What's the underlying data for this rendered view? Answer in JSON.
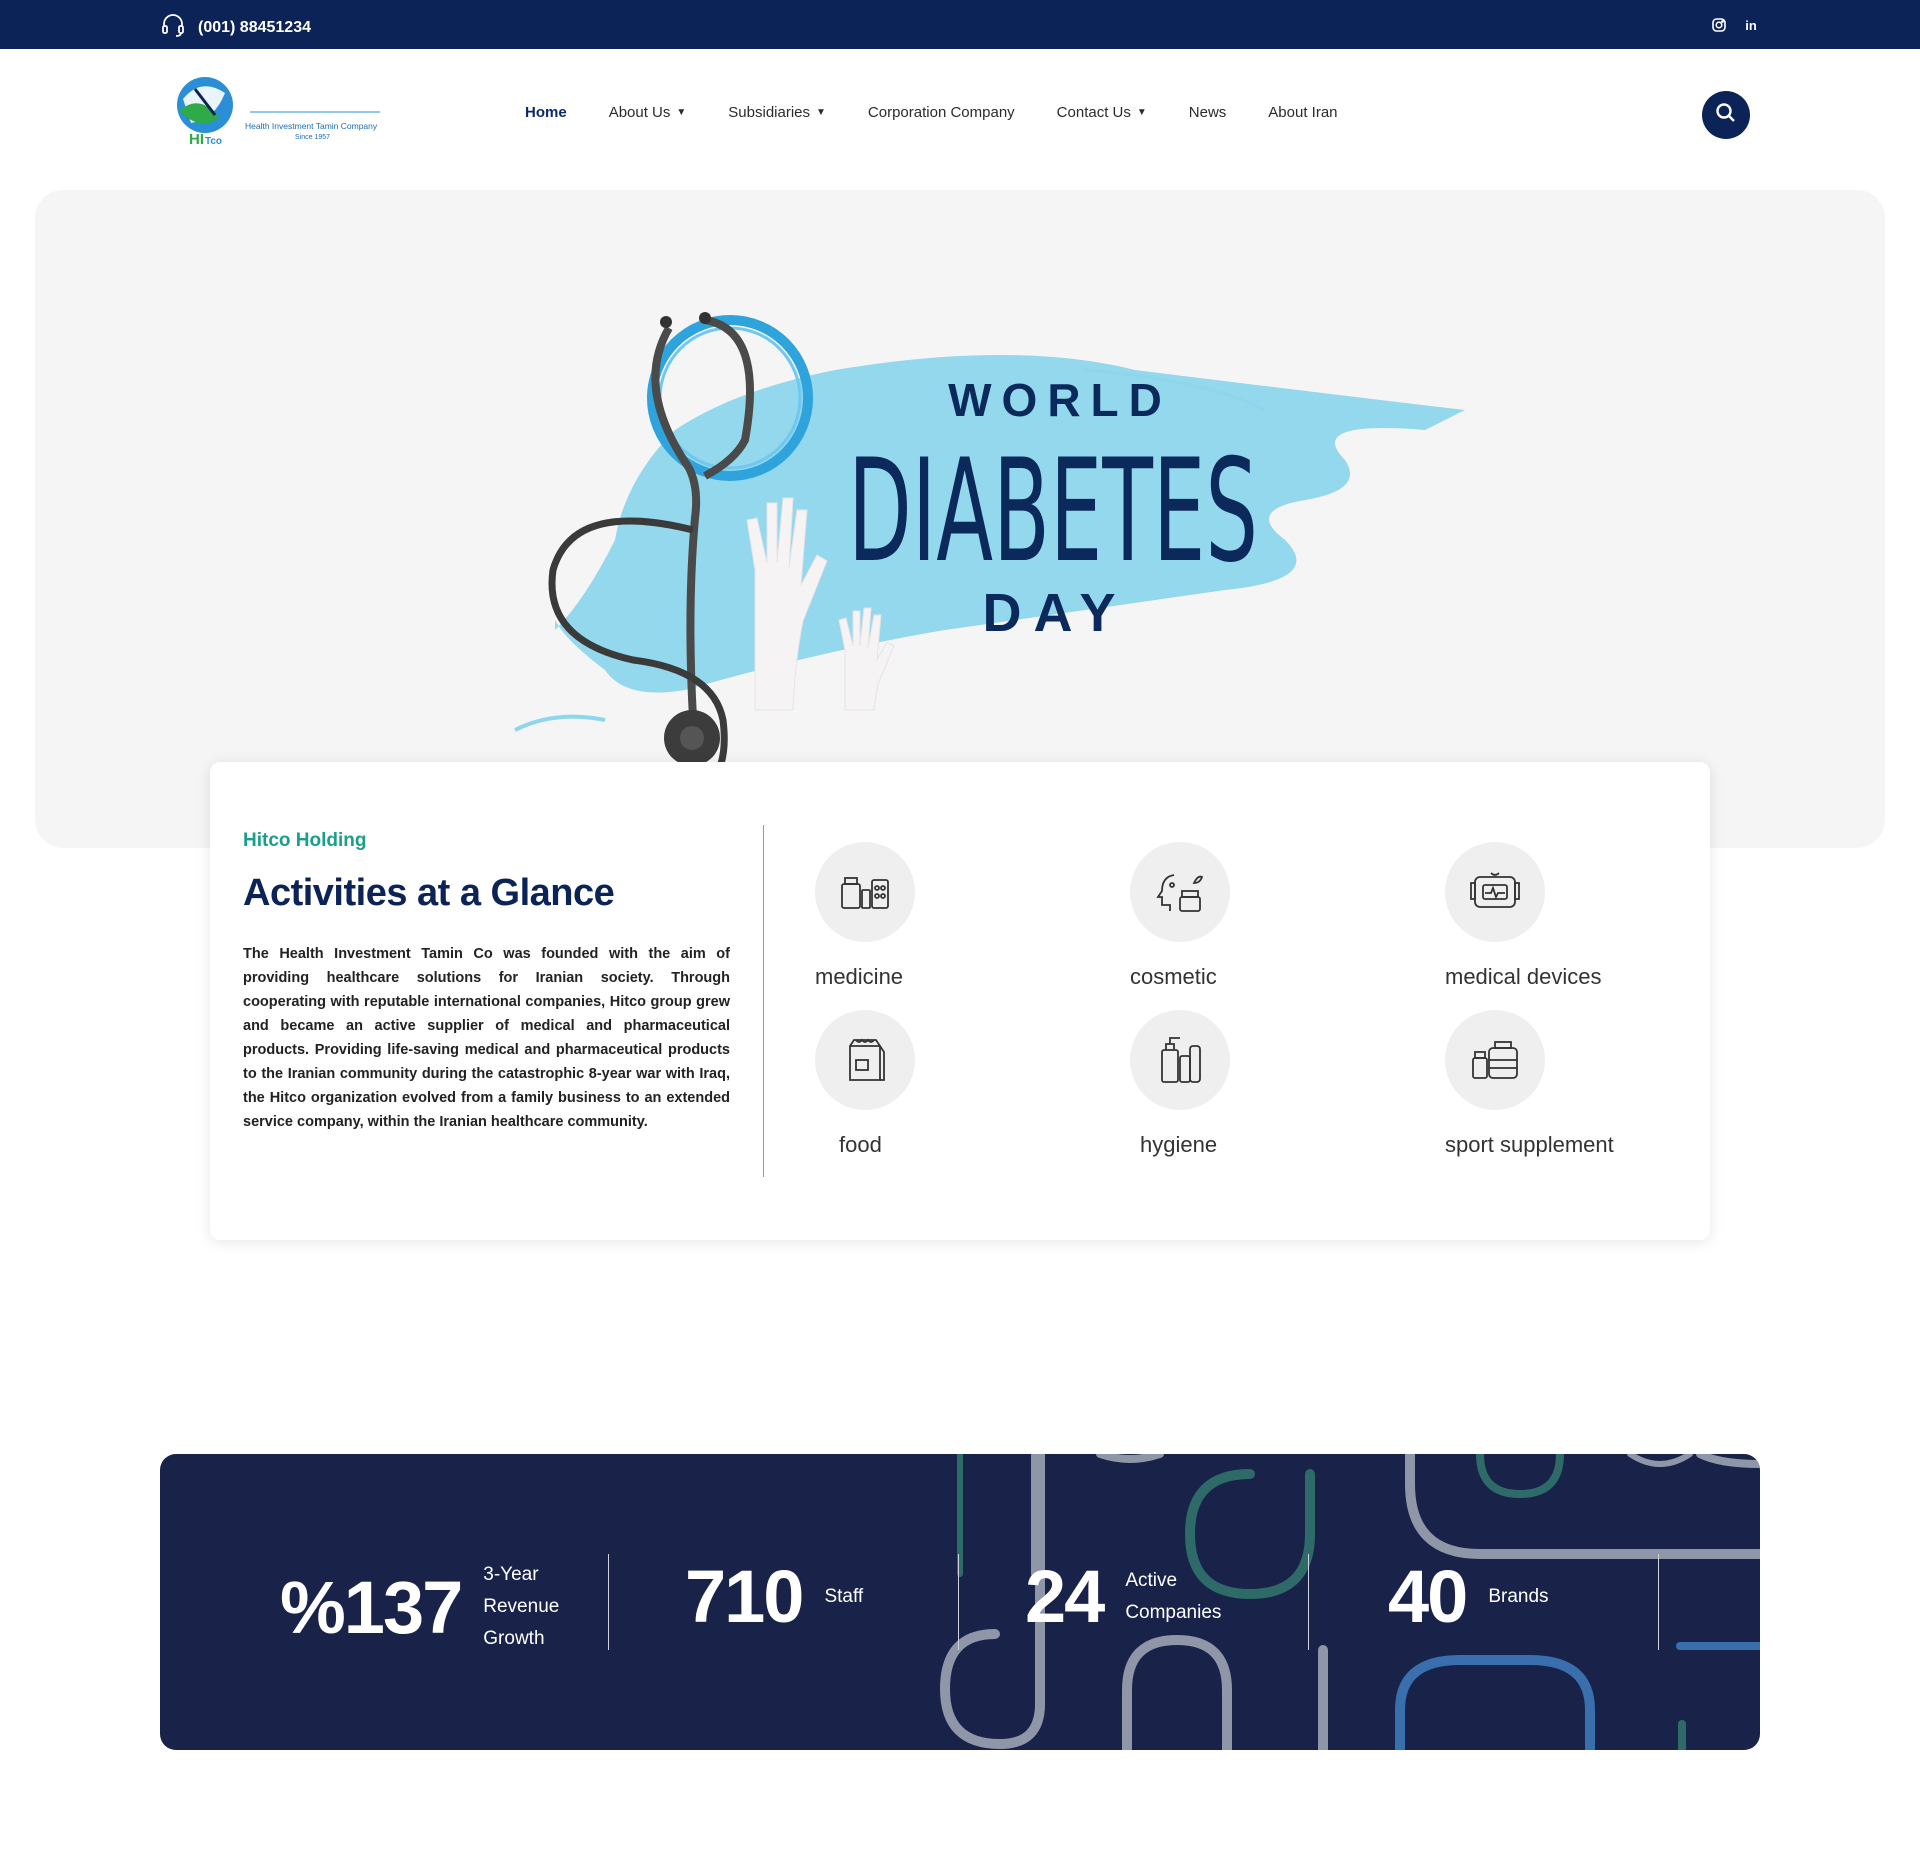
{
  "topbar": {
    "phone": "(001) 88451234",
    "social": [
      "instagram-icon",
      "linkedin-icon"
    ]
  },
  "header": {
    "logo_text": "HITco",
    "logo_caption": "Health Investment Tamin Company",
    "logo_since": "Since 1957",
    "nav": [
      {
        "label": "Home",
        "active": true,
        "dropdown": false
      },
      {
        "label": "About Us",
        "active": false,
        "dropdown": true
      },
      {
        "label": "Subsidiaries",
        "active": false,
        "dropdown": true
      },
      {
        "label": "Corporation Company",
        "active": false,
        "dropdown": false
      },
      {
        "label": "Contact Us",
        "active": false,
        "dropdown": true
      },
      {
        "label": "News",
        "active": false,
        "dropdown": false
      },
      {
        "label": "About Iran",
        "active": false,
        "dropdown": false
      }
    ]
  },
  "hero": {
    "line1": "WORLD",
    "line2": "DIABETES",
    "line3": "DAY"
  },
  "activities": {
    "eyebrow": "Hitco Holding",
    "title": "Activities at a Glance",
    "description": "The Health Investment Tamin Co was founded with the aim of providing healthcare solutions for Iranian society. Through cooperating with reputable international companies, Hitco group grew and became an active supplier of medical and pharmaceutical products. Providing life-saving medical and pharmaceutical products to the Iranian community during the catastrophic 8-year war with Iraq, the Hitco organization evolved from a family business to an extended service company, within the Iranian healthcare community.",
    "items": [
      {
        "label": "medicine",
        "icon": "medicine-icon"
      },
      {
        "label": "cosmetic",
        "icon": "cosmetic-icon"
      },
      {
        "label": "medical devices",
        "icon": "medical-devices-icon"
      },
      {
        "label": "food",
        "icon": "food-icon"
      },
      {
        "label": "hygiene",
        "icon": "hygiene-icon"
      },
      {
        "label": "sport supplement",
        "icon": "sport-supplement-icon"
      }
    ]
  },
  "stats": [
    {
      "value": "%137",
      "label": "3-Year Revenue Growth"
    },
    {
      "value": "710",
      "label": "Staff"
    },
    {
      "value": "24",
      "label": "Active Companies"
    },
    {
      "value": "40",
      "label": "Brands"
    }
  ],
  "colors": {
    "navy": "#0b2356",
    "teal": "#1aa08a",
    "hero_blue": "#8dd6ec",
    "stats_bg": "#19234a"
  }
}
